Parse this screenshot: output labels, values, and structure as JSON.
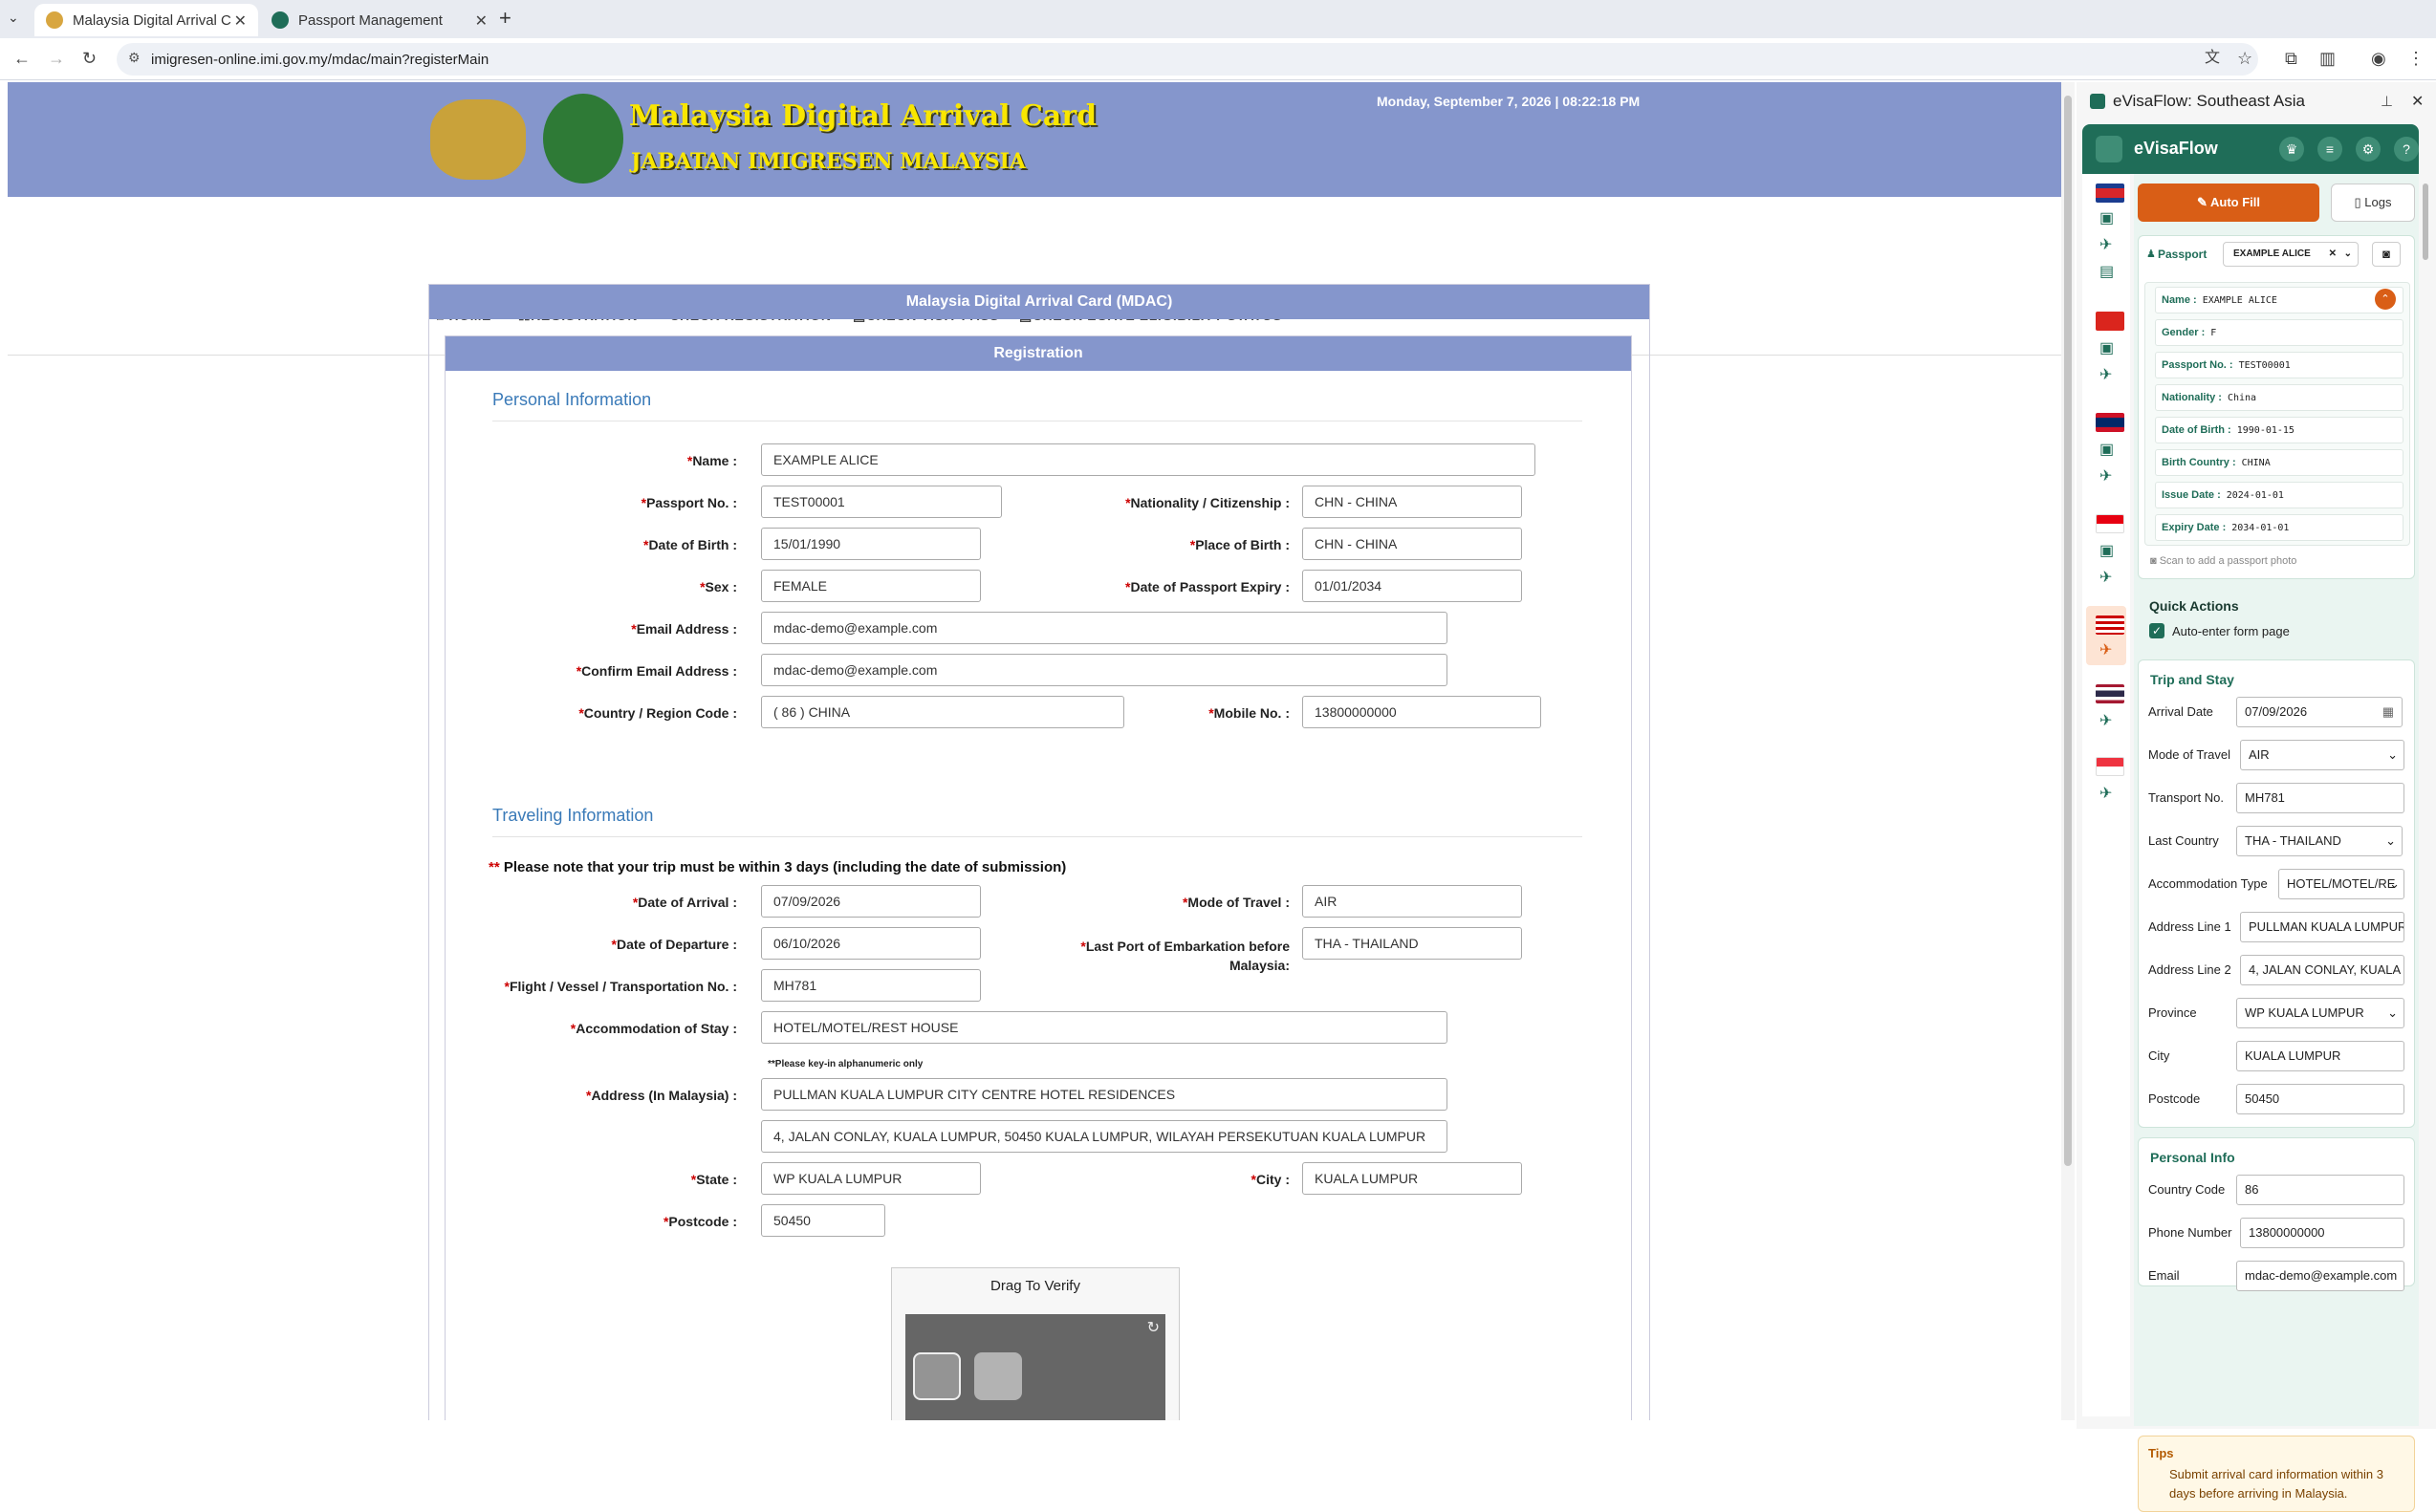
{
  "browser": {
    "tabs": [
      {
        "title": "Malaysia Digital Arrival C",
        "active": true
      },
      {
        "title": "Passport Management",
        "active": false
      }
    ],
    "url": "imigresen-online.imi.gov.my/mdac/main?registerMain"
  },
  "page": {
    "title_main": "Malaysia Digital Arrival Card",
    "title_sub": "JABATAN IMIGRESEN MALAYSIA",
    "datetime": "Monday, September 7, 2026 | 08:22:18 PM",
    "nav": [
      "HOME",
      "REGISTRATION",
      "CHECK REGISTRATION",
      "CHECK VISIT PASS",
      "CHECK EGATE ELIGIBILITY STATUS"
    ],
    "panel_title": "Malaysia Digital Arrival Card (MDAC)",
    "subpanel_title": "Registration",
    "personal": {
      "heading": "Personal Information",
      "name_label": "Name :",
      "name": "EXAMPLE ALICE",
      "passport_label": "Passport No. :",
      "passport": "TEST00001",
      "nationality_label": "Nationality / Citizenship :",
      "nationality": "CHN - CHINA",
      "dob_label": "Date of Birth :",
      "dob": "15/01/1990",
      "pob_label": "Place of Birth :",
      "pob": "CHN - CHINA",
      "sex_label": "Sex :",
      "sex": "FEMALE",
      "expiry_label": "Date of Passport Expiry :",
      "expiry": "01/01/2034",
      "email_label": "Email Address :",
      "email": "mdac-demo@example.com",
      "confirm_email_label": "Confirm Email Address :",
      "confirm_email": "mdac-demo@example.com",
      "country_code_label": "Country / Region Code :",
      "country_code": "( 86 ) CHINA",
      "mobile_label": "Mobile No. :",
      "mobile": "13800000000"
    },
    "travel": {
      "heading": "Traveling Information",
      "note_mark": "**",
      "note": "Please note that your trip must be within 3 days (including the date of submission)",
      "arrival_label": "Date of Arrival :",
      "arrival": "07/09/2026",
      "mode_label": "Mode of Travel :",
      "mode": "AIR",
      "departure_label": "Date of Departure :",
      "departure": "06/10/2026",
      "last_port_label_1": "Last Port of Embarkation before",
      "last_port_label_2": "Malaysia:",
      "last_port": "THA - THAILAND",
      "flight_label": "Flight / Vessel / Transportation No. :",
      "flight": "MH781",
      "accom_label": "Accommodation of Stay :",
      "accom": "HOTEL/MOTEL/REST HOUSE",
      "alnum_note": "**Please key-in alphanumeric only",
      "address_label": "Address (In Malaysia) :",
      "address1": "PULLMAN KUALA LUMPUR CITY CENTRE HOTEL  RESIDENCES",
      "address2": "4, JALAN CONLAY, KUALA LUMPUR, 50450 KUALA LUMPUR, WILAYAH PERSEKUTUAN KUALA LUMPUR",
      "state_label": "State :",
      "state": "WP KUALA LUMPUR",
      "city_label": "City :",
      "city": "KUALA LUMPUR",
      "postcode_label": "Postcode :",
      "postcode": "50450"
    },
    "captcha_title": "Drag To Verify"
  },
  "extension": {
    "window_title": "eVisaFlow: Southeast Asia",
    "brand": "eVisaFlow",
    "auto_fill": "Auto Fill",
    "logs": "Logs",
    "passport_label": "Passport",
    "passport_selected": "EXAMPLE ALICE",
    "fields": [
      {
        "label": "Name :",
        "value": "EXAMPLE ALICE"
      },
      {
        "label": "Gender :",
        "value": "F"
      },
      {
        "label": "Passport No. :",
        "value": "TEST00001"
      },
      {
        "label": "Nationality :",
        "value": "China"
      },
      {
        "label": "Date of Birth :",
        "value": "1990-01-15"
      },
      {
        "label": "Birth Country :",
        "value": "CHINA"
      },
      {
        "label": "Issue Date :",
        "value": "2024-01-01"
      },
      {
        "label": "Expiry Date :",
        "value": "2034-01-01"
      }
    ],
    "scan_hint": "Scan to add a passport photo",
    "quick_actions": "Quick Actions",
    "auto_enter": "Auto-enter form page",
    "trip_heading": "Trip and Stay",
    "trip": [
      {
        "label": "Arrival Date",
        "value": "07/09/2026"
      },
      {
        "label": "Mode of Travel",
        "value": "AIR"
      },
      {
        "label": "Transport No.",
        "value": "MH781"
      },
      {
        "label": "Last Country",
        "value": "THA - THAILAND"
      },
      {
        "label": "Accommodation Type",
        "value": "HOTEL/MOTEL/RE"
      },
      {
        "label": "Address Line 1",
        "value": "PULLMAN KUALA LUMPUR"
      },
      {
        "label": "Address Line 2",
        "value": "4, JALAN CONLAY, KUALA"
      },
      {
        "label": "Province",
        "value": "WP KUALA LUMPUR"
      },
      {
        "label": "City",
        "value": "KUALA LUMPUR"
      },
      {
        "label": "Postcode",
        "value": "50450"
      }
    ],
    "personal_heading": "Personal Info",
    "personal": [
      {
        "label": "Country Code",
        "value": "86"
      },
      {
        "label": "Phone Number",
        "value": "13800000000"
      },
      {
        "label": "Email",
        "value": "mdac-demo@example.com"
      }
    ],
    "tips_heading": "Tips",
    "tips_text_1": "Submit arrival card information within 3",
    "tips_text_2": "days before arriving in Malaysia."
  },
  "colors": {
    "header": "#8596cc",
    "brand": "#1f6d58",
    "accent": "#d95e16",
    "title_yellow": "#f9e600"
  }
}
